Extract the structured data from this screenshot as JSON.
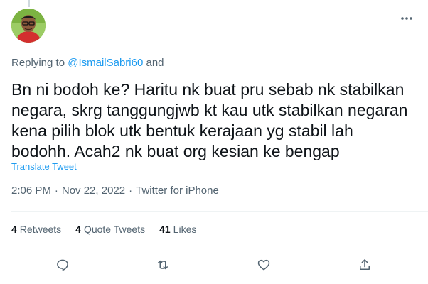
{
  "replying": {
    "prefix": "Replying to",
    "mention": "@IsmailSabri60",
    "suffix": "and"
  },
  "tweet": {
    "lines": [
      "Bn ni bodoh ke? Haritu nk buat pru sebab nk stabilkan",
      "negara, skrg tanggungjwb kt kau utk stabilkan negaran",
      "kena pilih blok utk bentuk kerajaan yg stabil lah",
      "bodohh. Acah2 nk buat org kesian ke bengap"
    ],
    "translate_label": "Translate Tweet"
  },
  "meta": {
    "time": "2:06 PM",
    "separator": "·",
    "date": "Nov 22, 2022",
    "source": "Twitter for iPhone"
  },
  "stats": {
    "retweets_count": "4",
    "retweets_label": "Retweets",
    "quotes_count": "4",
    "quotes_label": "Quote Tweets",
    "likes_count": "41",
    "likes_label": "Likes"
  },
  "icons": {
    "more": "more-dots-icon",
    "reply": "reply-icon",
    "retweet": "retweet-icon",
    "like": "heart-icon",
    "share": "share-icon"
  },
  "colors": {
    "accent": "#1d9bf0",
    "text": "#0f1419",
    "secondary": "#536471",
    "divider": "#eff3f4"
  }
}
